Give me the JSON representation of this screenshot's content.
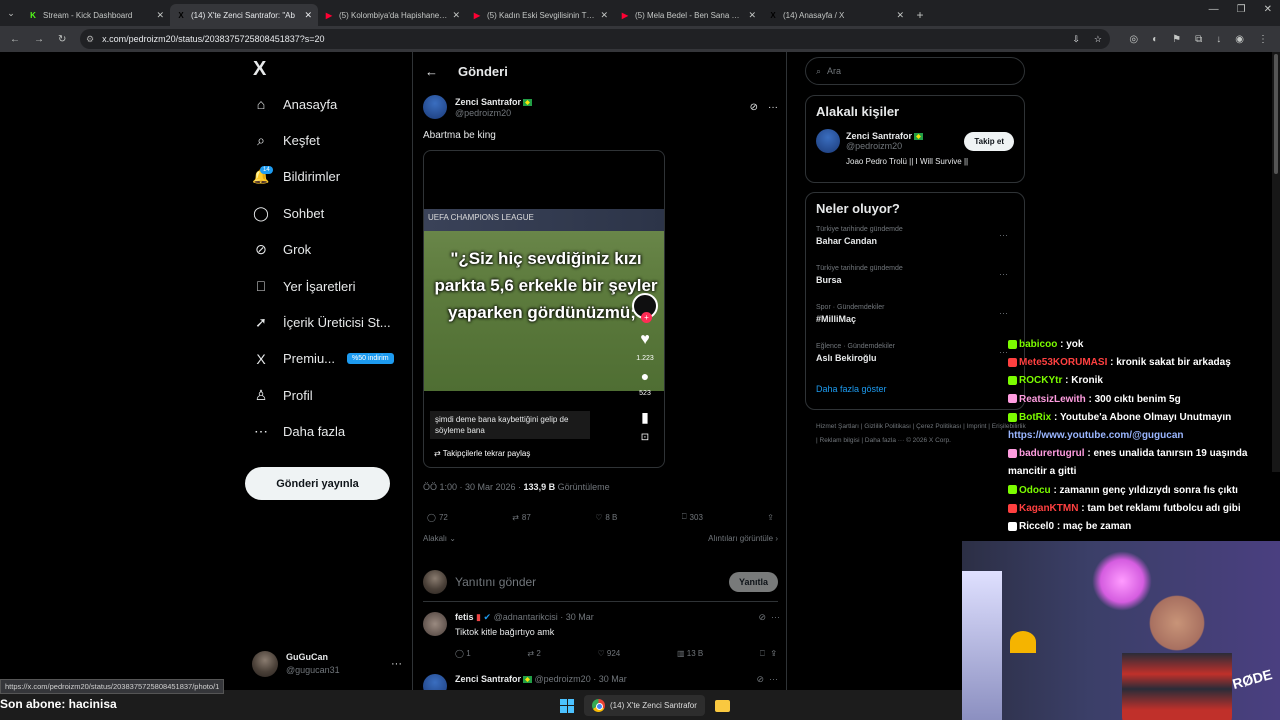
{
  "browser": {
    "tabs": [
      {
        "title": "Stream - Kick Dashboard",
        "color": "#53fc18",
        "glyph": "K"
      },
      {
        "title": "(14) X'te Zenci Santrafor: \"Ab",
        "color": "#000000",
        "glyph": "X",
        "active": true
      },
      {
        "title": "(5) Kolombiya'da Hapishane Ba",
        "color": "#ff0033",
        "glyph": "▶"
      },
      {
        "title": "(5) Kadın Eski Sevgilisinin Tüm",
        "color": "#ff0033",
        "glyph": "▶"
      },
      {
        "title": "(5) Mela Bedel - Ben Sana Geler",
        "color": "#ff0033",
        "glyph": "▶"
      },
      {
        "title": "(14) Anasayfa / X",
        "color": "#000000",
        "glyph": "X"
      }
    ],
    "url": "x.com/pedroizm20/status/2038375725808451837?s=20",
    "status_url": "https://x.com/pedroizm20/status/2038375725808451837/photo/1"
  },
  "sidebar": {
    "logo": "X",
    "items": [
      {
        "label": "Anasayfa",
        "icon": "⌂"
      },
      {
        "label": "Keşfet",
        "icon": "⌕"
      },
      {
        "label": "Bildirimler",
        "icon": "🔔",
        "badge": "14"
      },
      {
        "label": "Sohbet",
        "icon": "◯"
      },
      {
        "label": "Grok",
        "icon": "⊘"
      },
      {
        "label": "Yer İşaretleri",
        "icon": "⎕"
      },
      {
        "label": "İçerik Üreticisi St...",
        "icon": "➚"
      },
      {
        "label": "Premiu...",
        "icon": "X",
        "pill": "%50 indirim"
      },
      {
        "label": "Profil",
        "icon": "♙"
      },
      {
        "label": "Daha fazla",
        "icon": "⋯"
      }
    ],
    "post_button": "Gönderi yayınla",
    "user": {
      "name": "GuGuCan",
      "handle": "@gugucan31"
    }
  },
  "main": {
    "title": "Gönderi",
    "post": {
      "name": "Zenci Santrafor",
      "handle": "@pedroizm20",
      "text": "Abartma be king",
      "video": {
        "band": "UEFA CHAMPIONS LEAGUE",
        "caption": "\"¿Siz hiç sevdiğiniz kızı parkta 5,6 erkekle bir şeyler yaparken gördünüzmü;\"",
        "likes": "1.223",
        "comments": "523",
        "subtitle": "şimdi deme bana kaybettiğini gelip de söyleme bana",
        "repost_label": "Takipçilerle tekrar paylaş"
      },
      "meta_time": "ÖÖ 1:00 · 30 Mar 2026 · ",
      "views": "133,9 B",
      "views_label": "Görüntüleme",
      "stats": {
        "replies": "72",
        "reposts": "87",
        "likes": "8 B",
        "bookmarks": "303"
      },
      "related": "Alakalı",
      "quotes": "Alıntıları görüntüle"
    },
    "reply_placeholder": "Yanıtını gönder",
    "reply_button": "Yanıtla",
    "comments": [
      {
        "name": "fetis",
        "handle": "@adnantarikcisi · 30 Mar",
        "text": "Tiktok kitle bağırtıyo amk",
        "replies": "1",
        "reposts": "2",
        "likes": "924",
        "views": "13 B"
      },
      {
        "name": "Zenci Santrafor",
        "handle": "@pedroizm20 · 30 Mar",
        "text": ""
      }
    ]
  },
  "right": {
    "search_placeholder": "Ara",
    "relevant_title": "Alakalı kişiler",
    "person": {
      "name": "Zenci Santrafor",
      "handle": "@pedroizm20",
      "follow": "Takip et",
      "bio": "Joao Pedro Trolü || I Will Survive ||"
    },
    "trends_title": "Neler oluyor?",
    "trends": [
      {
        "context": "Türkiye tarihinde gündemde",
        "title": "Bahar Candan"
      },
      {
        "context": "Türkiye tarihinde gündemde",
        "title": "Bursa"
      },
      {
        "context": "Spor · Gündemdekiler",
        "title": "#MilliMaç"
      },
      {
        "context": "Eğlence · Gündemdekiler",
        "title": "Aslı Bekiroğlu"
      }
    ],
    "show_more": "Daha fazla göster",
    "footer": "Hizmet Şartları | Gizlilik Politikası | Çerez Politikası | Imprint | Erişilebilirlik | Reklam bilgisi | Daha fazla ··· © 2026 X Corp."
  },
  "chat": [
    {
      "user": "babicoo",
      "color": "#7cfc00",
      "text": ": yok"
    },
    {
      "user": "Mete53KORUMASI",
      "color": "#ff4040",
      "text": ": kronik sakat bir arkadaş"
    },
    {
      "user": "ROCKYtr",
      "color": "#7cfc00",
      "text": ": Kronik"
    },
    {
      "user": "ReatsizLewith",
      "color": "#ff9de0",
      "text": ": 300 cıktı benim 5g"
    },
    {
      "user": "BotRix",
      "color": "#7cfc00",
      "text": ": Youtube'a Abone Olmayı Unutmayın"
    },
    {
      "user": "",
      "color": "#9ab6ff",
      "text": "https://www.youtube.com/@gugucan"
    },
    {
      "user": "badurertugrul",
      "color": "#ff9de0",
      "text": ": enes unalida tanırsın 19 uaşında mancitir a gitti"
    },
    {
      "user": "Odocu",
      "color": "#7cfc00",
      "text": ": zamanın genç yıldızıydı sonra fıs çıktı"
    },
    {
      "user": "KaganKTMN",
      "color": "#ff4040",
      "text": ": tam bet reklamı futbolcu adı gibi"
    },
    {
      "user": "Riccel0",
      "color": "#ffffff",
      "text": ": maç be zaman"
    }
  ],
  "overlay": {
    "sub_text": "Son abone: hacinisa",
    "mic_brand": "RØDE"
  },
  "taskbar": {
    "app_label": "(14) X'te Zenci Santrafor"
  }
}
